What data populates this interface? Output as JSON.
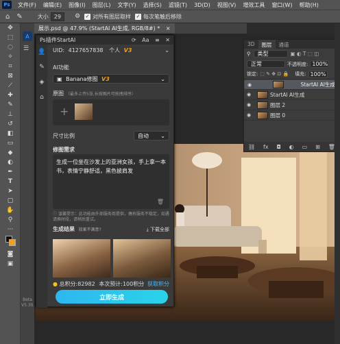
{
  "menubar": {
    "logo": "Ps",
    "items": [
      "文件(F)",
      "编辑(E)",
      "图像(I)",
      "图层(L)",
      "文字(Y)",
      "选择(S)",
      "滤镜(T)",
      "3D(D)",
      "视图(V)",
      "增效工具",
      "窗口(W)",
      "帮助(H)"
    ]
  },
  "options": {
    "size_label": "大小",
    "size_value": "29",
    "sample_all": "对所有图层取样",
    "sample_each": "每次笔触后移除"
  },
  "document": {
    "tab_title": "展示.psd @ 47.9% (StartAI AI生成, RGB/8#) *",
    "close": "×",
    "version": "Beta V5.30.4"
  },
  "plugin": {
    "title": "Ps插件StartAI",
    "uid_label": "UID:",
    "uid": "4127657838",
    "account_type": "个人",
    "account_badge": "V3",
    "ai_function_label": "AI功能",
    "model_name": "Banana修图",
    "model_badge": "V3",
    "base_image_label": "原图",
    "base_image_hint": "（最多上传5张,长按图片可拖拽排序）",
    "aspect_label": "尺寸比例",
    "aspect_value": "自动",
    "prompt_label": "修图需求",
    "prompt_text": "生成一位坐在沙发上的亚洲女孩，手上拿一本书，表情宁静舒适，黑色披肩发",
    "disclaimer": "温馨提示：此功能由外部服务商提供，偶有服务不稳定，如遇请换时段，请稍后重试。",
    "results_label": "生成结果",
    "results_unsatisfied": "效果不满意?",
    "download_all": "下载全部",
    "total_points_label": "总积分:",
    "total_points": "82982",
    "estimate_label": "本次预计:",
    "estimate": "100积分",
    "get_points": "获取积分",
    "generate": "立即生成"
  },
  "layers": {
    "tabs": [
      "3D",
      "图层",
      "通道"
    ],
    "kind": "类型",
    "blend": "正常",
    "opacity_label": "不透明度:",
    "opacity": "100%",
    "lock_label": "锁定:",
    "fill_label": "填充:",
    "fill": "100%",
    "items": [
      {
        "name": "StartAI AI生成",
        "selected": true
      },
      {
        "name": "StartAI AI生成",
        "selected": false
      },
      {
        "name": "图层 2",
        "selected": false
      },
      {
        "name": "图层 0",
        "selected": false
      }
    ],
    "footer_icons": [
      "link-icon",
      "fx-icon",
      "mask-icon",
      "adjust-icon",
      "folder-icon",
      "new-layer-icon",
      "trash-icon"
    ]
  },
  "colors": {
    "accent": "#2fb7f0",
    "badge": "#f0a020",
    "panel": "#3a3a3a"
  }
}
